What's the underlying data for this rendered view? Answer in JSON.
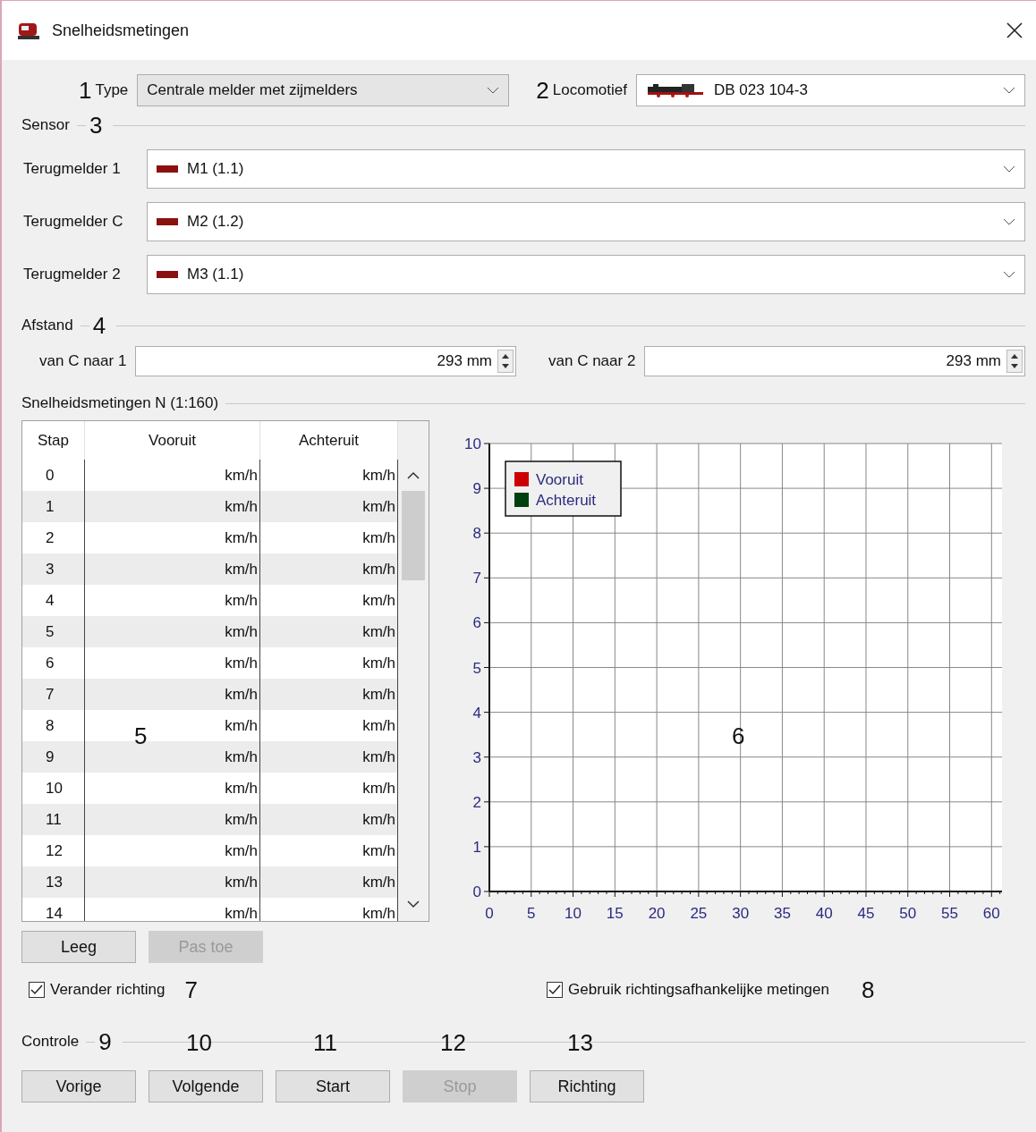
{
  "window": {
    "title": "Snelheidsmetingen"
  },
  "top": {
    "type_callout": "1",
    "type_label": "Type",
    "type_value": "Centrale melder met zijmelders",
    "loco_callout": "2",
    "loco_label": "Locomotief",
    "loco_value": "DB 023 104-3"
  },
  "sensor": {
    "title": "Sensor",
    "callout": "3",
    "rows": [
      {
        "label": "Terugmelder 1",
        "value": "M1 (1.1)"
      },
      {
        "label": "Terugmelder C",
        "value": "M2 (1.2)"
      },
      {
        "label": "Terugmelder 2",
        "value": "M3 (1.1)"
      }
    ]
  },
  "distance": {
    "title": "Afstand",
    "callout": "4",
    "fields": [
      {
        "label": "van C naar 1",
        "value": "293 mm"
      },
      {
        "label": "van C naar 2",
        "value": "293 mm"
      }
    ]
  },
  "measurements": {
    "title": "Snelheidsmetingen N (1:160)",
    "table_callout": "5",
    "chart_callout": "6",
    "columns": [
      "Stap",
      "Vooruit",
      "Achteruit"
    ],
    "rows": [
      {
        "step": "0",
        "forward": "km/h",
        "backward": "km/h"
      },
      {
        "step": "1",
        "forward": "km/h",
        "backward": "km/h"
      },
      {
        "step": "2",
        "forward": "km/h",
        "backward": "km/h"
      },
      {
        "step": "3",
        "forward": "km/h",
        "backward": "km/h"
      },
      {
        "step": "4",
        "forward": "km/h",
        "backward": "km/h"
      },
      {
        "step": "5",
        "forward": "km/h",
        "backward": "km/h"
      },
      {
        "step": "6",
        "forward": "km/h",
        "backward": "km/h"
      },
      {
        "step": "7",
        "forward": "km/h",
        "backward": "km/h"
      },
      {
        "step": "8",
        "forward": "km/h",
        "backward": "km/h"
      },
      {
        "step": "9",
        "forward": "km/h",
        "backward": "km/h"
      },
      {
        "step": "10",
        "forward": "km/h",
        "backward": "km/h"
      },
      {
        "step": "11",
        "forward": "km/h",
        "backward": "km/h"
      },
      {
        "step": "12",
        "forward": "km/h",
        "backward": "km/h"
      },
      {
        "step": "13",
        "forward": "km/h",
        "backward": "km/h"
      },
      {
        "step": "14",
        "forward": "km/h",
        "backward": "km/h"
      }
    ],
    "table_buttons": [
      {
        "label": "Leeg",
        "disabled": false
      },
      {
        "label": "Pas toe",
        "disabled": true
      }
    ],
    "chart_data": {
      "type": "line",
      "grid": true,
      "ylim": [
        0,
        10
      ],
      "categories": [
        "0",
        "5",
        "10",
        "15",
        "20",
        "25",
        "30",
        "35",
        "40",
        "45",
        "50",
        "55",
        "60"
      ],
      "yticks": [
        0,
        1,
        2,
        3,
        4,
        5,
        6,
        7,
        8,
        9,
        10
      ],
      "series": [
        {
          "name": "Vooruit",
          "color": "#cc0000",
          "values": [
            null,
            null,
            null,
            null,
            null,
            null,
            null,
            null,
            null,
            null,
            null,
            null,
            null
          ]
        },
        {
          "name": "Achteruit",
          "color": "#004010",
          "values": [
            null,
            null,
            null,
            null,
            null,
            null,
            null,
            null,
            null,
            null,
            null,
            null,
            null
          ]
        }
      ]
    }
  },
  "options": [
    {
      "label": "Verander richting",
      "checked": true,
      "callout": "7"
    },
    {
      "label": "Gebruik richtingsafhankelijke metingen",
      "checked": true,
      "callout": "8"
    }
  ],
  "control": {
    "title": "Controle",
    "callout": "9",
    "buttons": [
      {
        "label": "Vorige",
        "disabled": false
      },
      {
        "label": "Volgende",
        "disabled": false,
        "callout": "10"
      },
      {
        "label": "Start",
        "disabled": false,
        "callout": "11"
      },
      {
        "label": "Stop",
        "disabled": true,
        "callout": "12"
      },
      {
        "label": "Richting",
        "disabled": false,
        "callout": "13"
      }
    ]
  }
}
